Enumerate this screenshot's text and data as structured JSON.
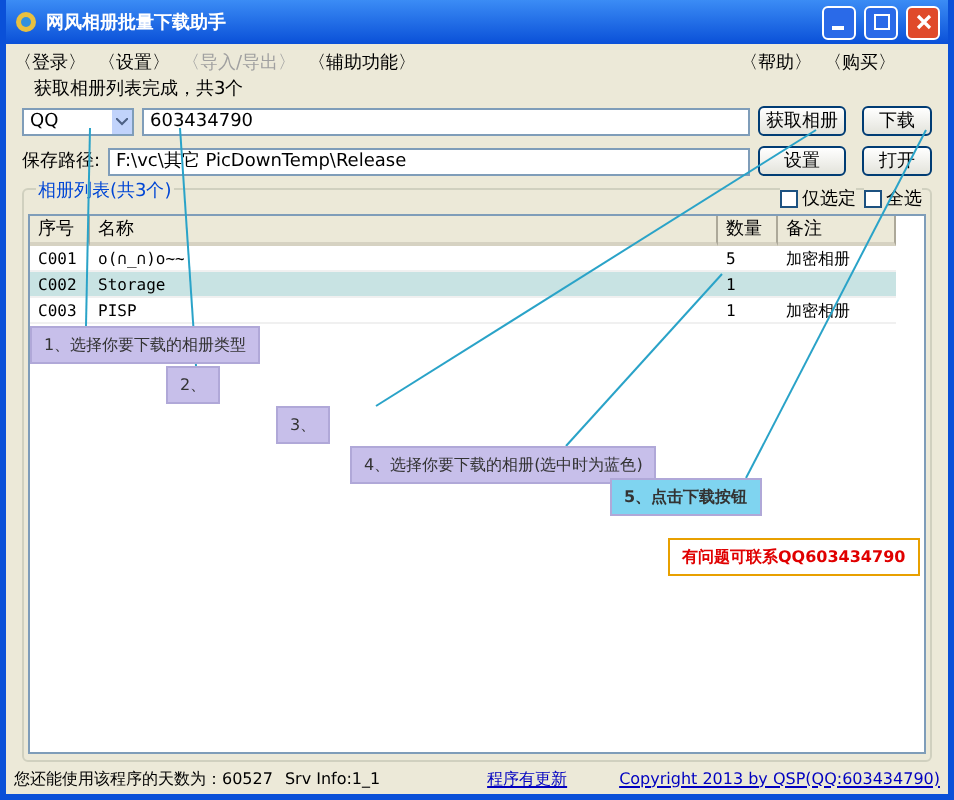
{
  "window": {
    "title": "网风相册批量下载助手"
  },
  "menu": [
    {
      "label": "〈登录〉",
      "disabled": false
    },
    {
      "label": "〈设置〉",
      "disabled": false
    },
    {
      "label": "〈导入/导出〉",
      "disabled": true
    },
    {
      "label": "〈辅助功能〉",
      "disabled": false
    },
    {
      "label": "〈帮助〉",
      "disabled": false
    },
    {
      "label": "〈购买〉",
      "disabled": false
    }
  ],
  "status_message": "获取相册列表完成，共3个",
  "account": {
    "type": "QQ",
    "number": "603434790",
    "fetch_button": "获取相册",
    "download_button": "下载"
  },
  "save_path": {
    "label": "保存路径:",
    "value": "F:\\vc\\其它 PicDownTemp\\Release",
    "settings_button": "设置",
    "open_button": "打开"
  },
  "album_list": {
    "title": "相册列表(共3个)",
    "options": [
      {
        "label": "仅选定",
        "checked": false
      },
      {
        "label": "全选",
        "checked": false
      }
    ],
    "columns": [
      "序号",
      "名称",
      "数量",
      "备注"
    ],
    "rows": [
      {
        "cells": [
          "C001",
          "o(∩_∩)o~~",
          "5",
          "加密相册"
        ],
        "selected": false
      },
      {
        "cells": [
          "C002",
          "Storage",
          "1",
          ""
        ],
        "selected": true
      },
      {
        "cells": [
          "C003",
          "PISP",
          "1",
          "加密相册"
        ],
        "selected": false
      }
    ]
  },
  "callouts": [
    {
      "text": "1、选择你要下载的相册类型",
      "kind": "step"
    },
    {
      "text": "2、",
      "kind": "step"
    },
    {
      "text": "3、",
      "kind": "step"
    },
    {
      "text": "4、选择你要下载的相册(选中时为蓝色)",
      "kind": "step"
    },
    {
      "text": "5、点击下载按钮",
      "kind": "highlight"
    },
    {
      "text": "有问题可联系QQ603434790",
      "kind": "contact"
    }
  ],
  "status_bar": {
    "days": "您还能使用该程序的天数为：60527",
    "server": "Srv Info:1_1",
    "update_link": "程序有更新",
    "copyright": "Copyright 2013 by QSP(QQ:603434790)"
  }
}
